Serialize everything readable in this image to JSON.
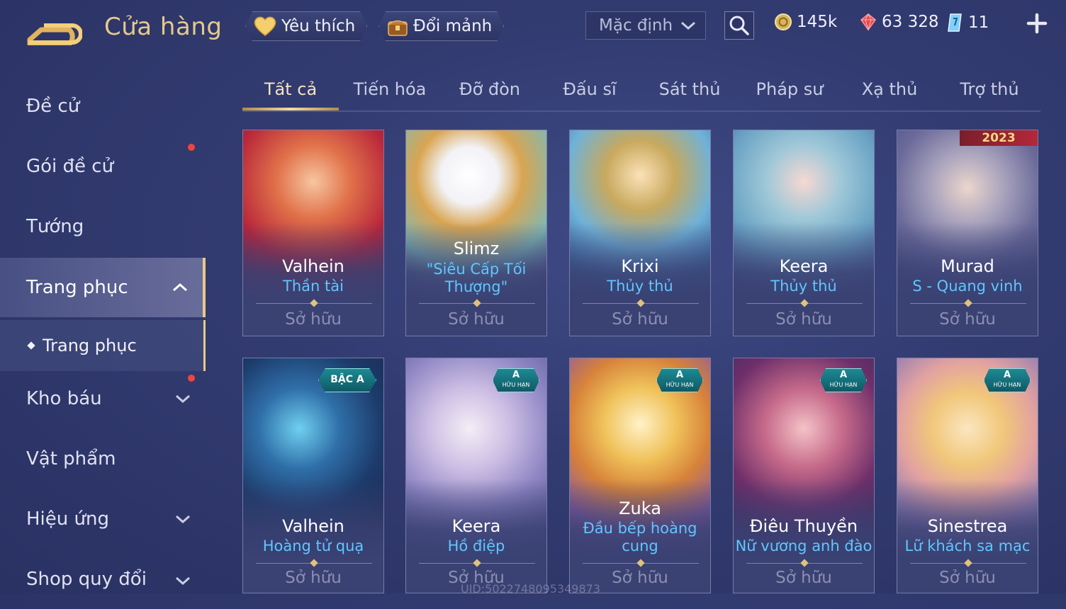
{
  "header": {
    "title": "Cửa hàng",
    "favorites_label": "Yêu thích",
    "exchange_label": "Đổi mảnh",
    "sort_value": "Mặc định",
    "coins": "145k",
    "gems": "63 328",
    "vouchers": "11"
  },
  "sidebar": {
    "items": [
      {
        "label": "Đề cử"
      },
      {
        "label": "Gói đề cử"
      },
      {
        "label": "Tướng"
      },
      {
        "label": "Trang phục"
      },
      {
        "label": "Kho báu"
      },
      {
        "label": "Vật phẩm"
      },
      {
        "label": "Hiệu ứng"
      },
      {
        "label": "Shop quy đổi"
      }
    ],
    "sub_item": "Trang phục"
  },
  "tabs": [
    "Tất cả",
    "Tiến hóa",
    "Đỡ đòn",
    "Đấu sĩ",
    "Sát thủ",
    "Pháp sư",
    "Xạ thủ",
    "Trợ thủ"
  ],
  "cards": [
    {
      "hero": "Valhein",
      "skin": "Thần tài",
      "status": "Sở hữu"
    },
    {
      "hero": "Slimz",
      "skin": "\"Siêu Cấp Tối Thượng\"",
      "status": "Sở hữu"
    },
    {
      "hero": "Krixi",
      "skin": "Thủy thủ",
      "status": "Sở hữu"
    },
    {
      "hero": "Keera",
      "skin": "Thủy thủ",
      "status": "Sở hữu"
    },
    {
      "hero": "Murad",
      "skin": "S - Quang vinh",
      "status": "Sở hữu",
      "tag": "2023"
    },
    {
      "hero": "Valhein",
      "skin": "Hoàng tử quạ",
      "status": "Sở hữu",
      "badge": "BẬC A"
    },
    {
      "hero": "Keera",
      "skin": "Hồ điệp",
      "status": "Sở hữu",
      "badge_top": "A",
      "badge_bottom": "HỮU HẠN"
    },
    {
      "hero": "Zuka",
      "skin": "Đầu bếp hoàng cung",
      "status": "Sở hữu",
      "badge_top": "A",
      "badge_bottom": "HỮU HẠN"
    },
    {
      "hero": "Điêu Thuyền",
      "skin": "Nữ vương anh đào",
      "status": "Sở hữu",
      "badge_top": "A",
      "badge_bottom": "HỮU HẠN"
    },
    {
      "hero": "Sinestrea",
      "skin": "Lữ khách sa mạc",
      "status": "Sở hữu",
      "badge_top": "A",
      "badge_bottom": "HỮU HẠN"
    }
  ],
  "uid": "UID:5022748095349873",
  "colors": {
    "accent_gold": "#e9c989",
    "skin_name_blue": "#5fc7ff",
    "notify_red": "#f0453c"
  }
}
